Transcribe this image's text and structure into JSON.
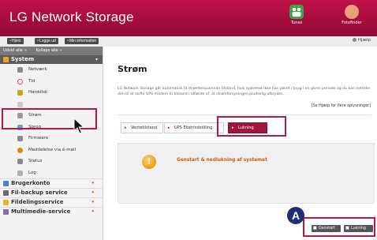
{
  "header": {
    "title": "LG Network Storage",
    "icons": [
      {
        "name": "tunes-icon",
        "label": "Tunes",
        "color": "#3aa542"
      },
      {
        "name": "photos-icon",
        "label": "Fotofinder",
        "color": "#e8a27a"
      }
    ]
  },
  "toolbar": {
    "buttons": [
      "Hjem",
      "Logge ud",
      "Min information"
    ],
    "help_label": "Hjælp"
  },
  "sidebar": {
    "top_links": [
      "Udvid alle",
      "Kollaps alle"
    ],
    "section": "System",
    "items": [
      {
        "label": "Netværk",
        "icon": "network-icon",
        "color": "#8a8a8a"
      },
      {
        "label": "Tid",
        "icon": "clock-icon",
        "color": "#e04b4b"
      },
      {
        "label": "Harddisk",
        "icon": "disk-icon",
        "color": "#d4a017"
      },
      {
        "label": "",
        "icon": "placeholder-icon",
        "color": "#cccccc"
      },
      {
        "label": "Strøm",
        "icon": "power-icon",
        "color": "#9a9a9a"
      },
      {
        "label": "Sprog",
        "icon": "language-icon",
        "color": "#6aa0d8"
      },
      {
        "label": "Firmware",
        "icon": "firmware-icon",
        "color": "#8a8a8a"
      },
      {
        "label": "Meddelelse via e-mail",
        "icon": "email-icon",
        "color": "#e8841a"
      },
      {
        "label": "Status",
        "icon": "status-icon",
        "color": "#8a8a8a"
      },
      {
        "label": "Log",
        "icon": "log-icon",
        "color": "#b0b0b0"
      }
    ],
    "categories": [
      {
        "label": "Brugerkonto",
        "icon": "user-account-icon",
        "color": "#4f81c7"
      },
      {
        "label": "Fil-backup service",
        "icon": "backup-icon",
        "color": "#6a6a6a"
      },
      {
        "label": "Fildelingsservice",
        "icon": "file-share-icon",
        "color": "#f2b31f"
      },
      {
        "label": "Multimedie-service",
        "icon": "multimedia-icon",
        "color": "#8a6aa8"
      }
    ]
  },
  "main": {
    "title": "Strøm",
    "description": "LG Network Storage går automatisk til strømbesparende tilstand, hvis systemet ikke har været i brug i en given periode og du kan indstille den til at skifte UPS-modem til tilstand i tilfælde af, at strømforsyningen pludselig afbrydes.",
    "see_help": "[Se Hjælp for flere oplysninger]",
    "tabs": [
      "Ventetilstand",
      "UPS Ekstrindstilling",
      "Lukning"
    ],
    "panel_label": "Genstart & nedlukning af systemet",
    "bottom_buttons": [
      "Genstart",
      "Lukning"
    ]
  },
  "annotation": {
    "marker": "A"
  },
  "colors": {
    "brand": "#a50d3d",
    "callout": "#b31942",
    "marker": "#1e2f74",
    "accent_orange": "#f6a21b"
  }
}
